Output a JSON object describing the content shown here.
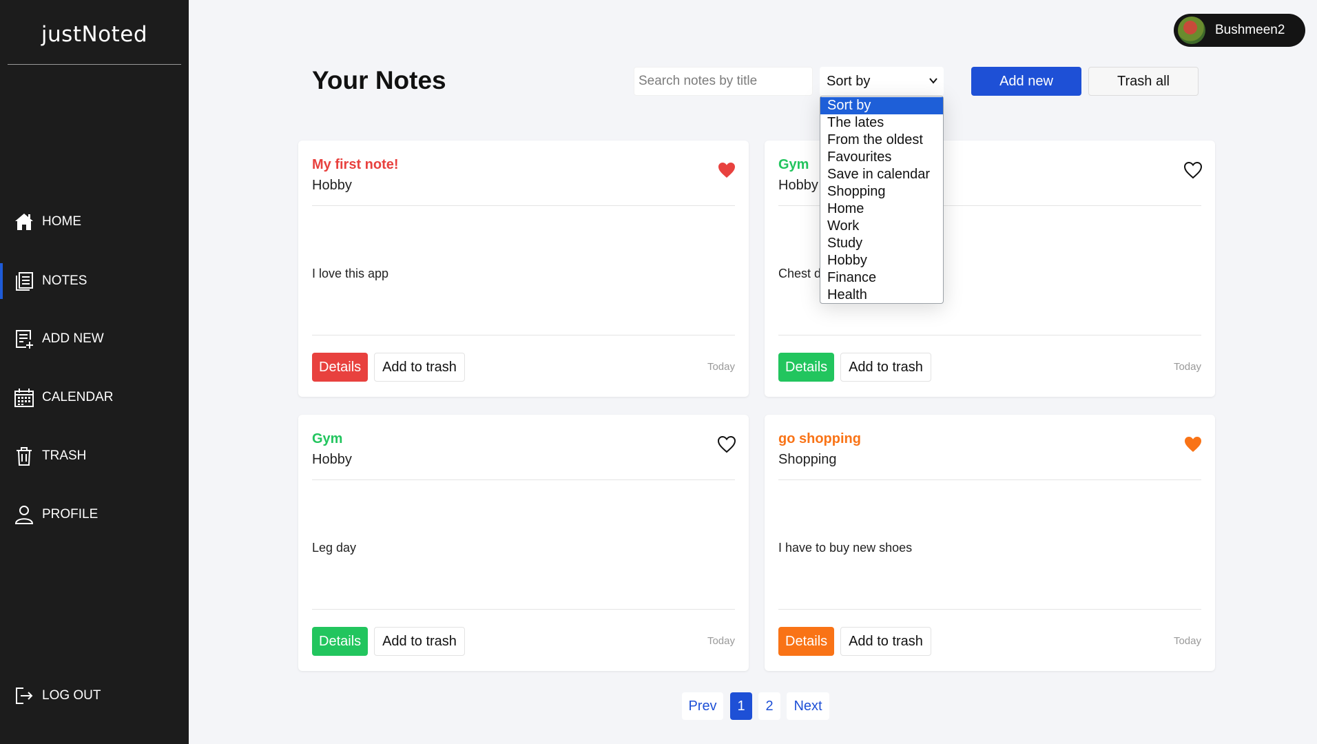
{
  "app": {
    "brand": "justNoted"
  },
  "sidebar": {
    "items": [
      {
        "label": "HOME",
        "icon": "home-icon"
      },
      {
        "label": "NOTES",
        "icon": "notes-icon",
        "active": true
      },
      {
        "label": "ADD NEW",
        "icon": "add-note-icon"
      },
      {
        "label": "CALENDAR",
        "icon": "calendar-icon"
      },
      {
        "label": "TRASH",
        "icon": "trash-icon"
      },
      {
        "label": "PROFILE",
        "icon": "user-icon"
      }
    ],
    "logout": {
      "label": "LOG OUT",
      "icon": "logout-icon"
    }
  },
  "user": {
    "name": "Bushmeen2"
  },
  "header": {
    "title": "Your Notes",
    "search_placeholder": "Search notes by title",
    "sort_value": "Sort by",
    "add_label": "Add new",
    "trash_all_label": "Trash all"
  },
  "sort_options": [
    "Sort by",
    "The lates",
    "From the oldest",
    "Favourites",
    "Save in calendar",
    "Shopping",
    "Home",
    "Work",
    "Study",
    "Hobby",
    "Finance",
    "Health"
  ],
  "notes": [
    {
      "title": "My first note!",
      "category": "Hobby",
      "body": "I love this app",
      "date": "Today",
      "favourite": true,
      "color": "#e8413e"
    },
    {
      "title": "Gym",
      "category": "Hobby",
      "body": "Chest day",
      "date": "Today",
      "favourite": false,
      "color": "#22c55e"
    },
    {
      "title": "Gym",
      "category": "Hobby",
      "body": "Leg day",
      "date": "Today",
      "favourite": false,
      "color": "#22c55e"
    },
    {
      "title": "go shopping",
      "category": "Shopping",
      "body": "I have to buy new shoes",
      "date": "Today",
      "favourite": true,
      "color": "#f97316"
    }
  ],
  "card_actions": {
    "details": "Details",
    "trash": "Add to trash"
  },
  "pagination": {
    "prev": "Prev",
    "pages": [
      "1",
      "2"
    ],
    "current": "1",
    "next": "Next"
  }
}
